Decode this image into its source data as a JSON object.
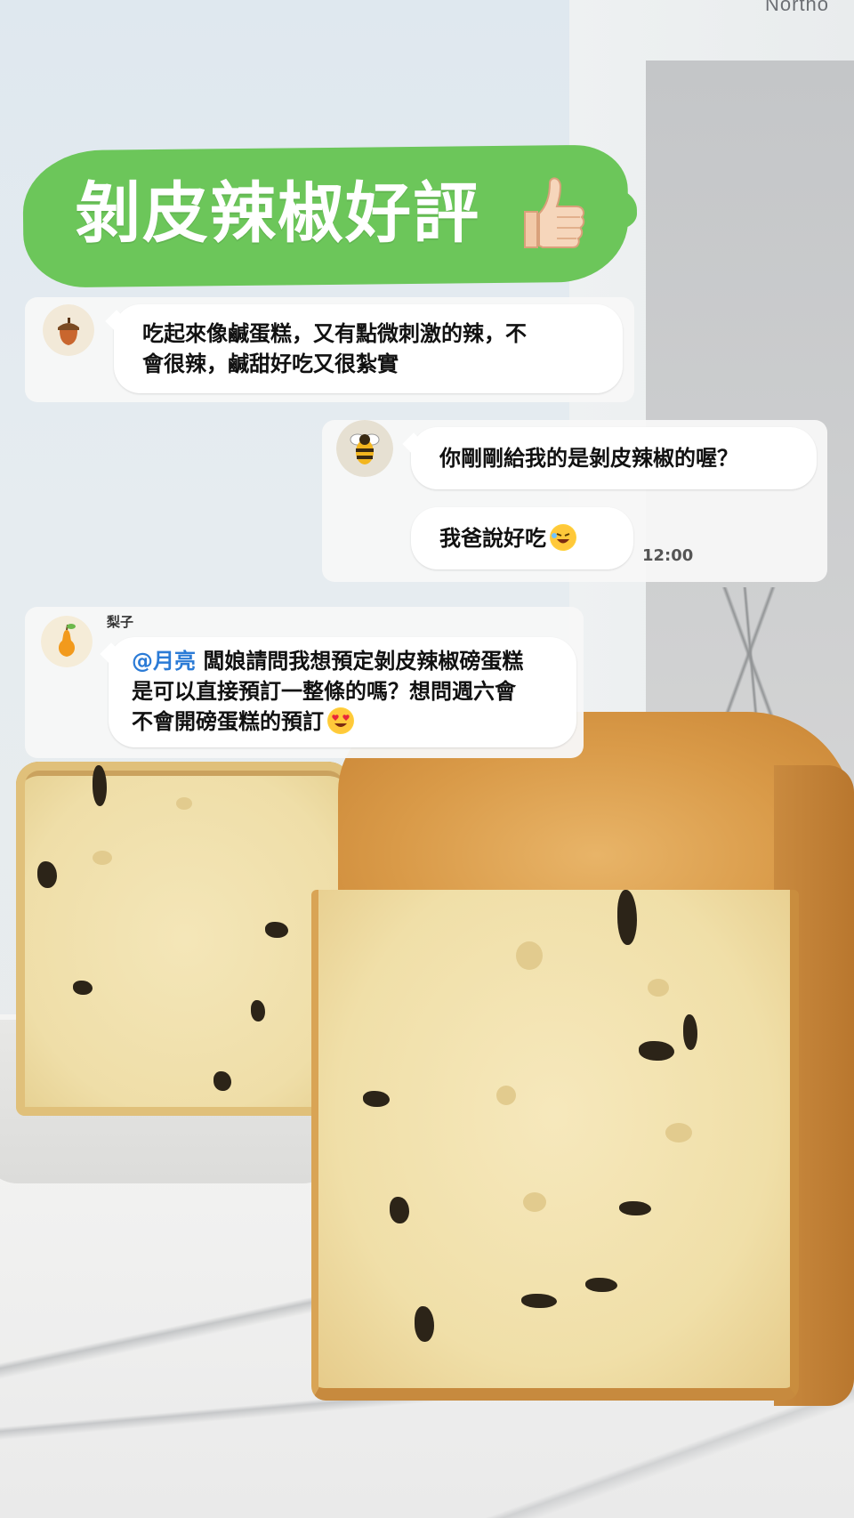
{
  "background": {
    "brand_text": "Northo"
  },
  "title": {
    "text": "剝皮辣椒好評",
    "badge_color": "#6cc65a",
    "thumb_icon": "thumbs-up-icon"
  },
  "messages": [
    {
      "avatar_icon": "acorn-icon",
      "bubbles": [
        {
          "text_line1": "吃起來像鹹蛋糕，又有點微刺激的辣，不",
          "text_line2": "會很辣，鹹甜好吃又很紮實"
        }
      ]
    },
    {
      "avatar_icon": "bee-icon",
      "bubbles": [
        {
          "text": "你剛剛給我的是剝皮辣椒的喔？"
        },
        {
          "text": "我爸說好吃",
          "emoji": "rofl-emoji-icon",
          "time": "12:00"
        }
      ]
    },
    {
      "sender": "梨子",
      "avatar_icon": "pear-icon",
      "bubbles": [
        {
          "mention": "@月亮",
          "text_line1": " 闆娘請問我想預定剝皮辣椒磅蛋糕",
          "text_line2": "是可以直接預訂一整條的嗎？想問週六會",
          "text_line3": "不會開磅蛋糕的預訂",
          "emoji": "heart-eyes-emoji-icon"
        }
      ]
    }
  ]
}
